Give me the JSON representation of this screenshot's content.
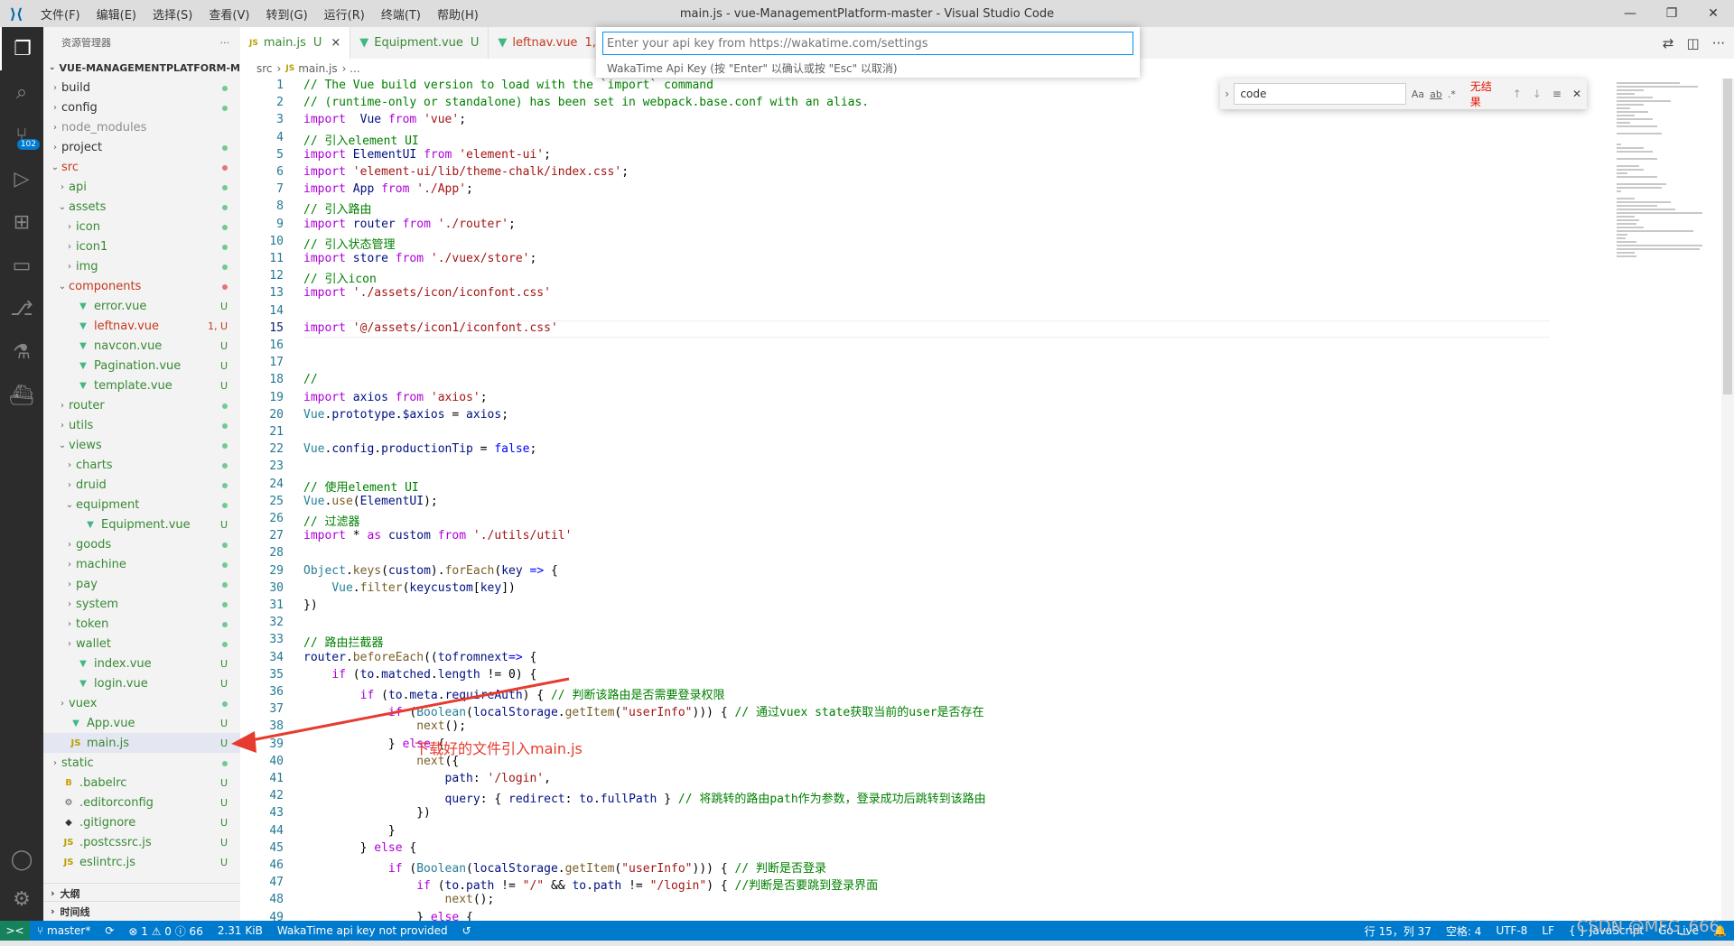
{
  "window": {
    "title": "main.js - vue-ManagementPlatform-master - Visual Studio Code",
    "menu": [
      "文件(F)",
      "编辑(E)",
      "选择(S)",
      "查看(V)",
      "转到(G)",
      "运行(R)",
      "终端(T)",
      "帮助(H)"
    ]
  },
  "activity_bar": {
    "icons": [
      "explorer-icon",
      "search-icon",
      "source-control-icon",
      "run-debug-icon",
      "extensions-icon",
      "remote-explorer-icon",
      "git-graph-icon",
      "testing-icon",
      "docker-icon"
    ],
    "scm_badge": "102",
    "bottom_icons": [
      "account-icon",
      "settings-gear-icon"
    ]
  },
  "explorer": {
    "header": "资源管理器",
    "more": "···",
    "root": "VUE-MANAGEMENTPLATFORM-MA...",
    "items": [
      {
        "label": "build",
        "indent": 0,
        "kind": "folder",
        "open": false,
        "status": "dot-green"
      },
      {
        "label": "config",
        "indent": 0,
        "kind": "folder",
        "open": false,
        "status": "dot-green"
      },
      {
        "label": "node_modules",
        "indent": 0,
        "kind": "folder",
        "open": false,
        "status": "",
        "muted": true
      },
      {
        "label": "project",
        "indent": 0,
        "kind": "folder",
        "open": false,
        "status": "dot-green"
      },
      {
        "label": "src",
        "indent": 0,
        "kind": "folder",
        "open": true,
        "status": "dot-red",
        "color": "#c5391d"
      },
      {
        "label": "api",
        "indent": 1,
        "kind": "folder",
        "open": false,
        "status": "dot-green",
        "color": "#388a34"
      },
      {
        "label": "assets",
        "indent": 1,
        "kind": "folder",
        "open": true,
        "status": "dot-green",
        "color": "#388a34"
      },
      {
        "label": "icon",
        "indent": 2,
        "kind": "folder",
        "open": false,
        "status": "dot-green",
        "color": "#388a34"
      },
      {
        "label": "icon1",
        "indent": 2,
        "kind": "folder",
        "open": false,
        "status": "dot-green",
        "color": "#388a34"
      },
      {
        "label": "img",
        "indent": 2,
        "kind": "folder",
        "open": false,
        "status": "dot-green",
        "color": "#388a34"
      },
      {
        "label": "components",
        "indent": 1,
        "kind": "folder",
        "open": true,
        "status": "dot-red",
        "color": "#c5391d"
      },
      {
        "label": "error.vue",
        "indent": 2,
        "kind": "vue",
        "status": "U",
        "color": "#388a34"
      },
      {
        "label": "leftnav.vue",
        "indent": 2,
        "kind": "vue",
        "status": "1, U",
        "color": "#c5391d"
      },
      {
        "label": "navcon.vue",
        "indent": 2,
        "kind": "vue",
        "status": "U",
        "color": "#388a34"
      },
      {
        "label": "Pagination.vue",
        "indent": 2,
        "kind": "vue",
        "status": "U",
        "color": "#388a34"
      },
      {
        "label": "template.vue",
        "indent": 2,
        "kind": "vue",
        "status": "U",
        "color": "#388a34"
      },
      {
        "label": "router",
        "indent": 1,
        "kind": "folder",
        "open": false,
        "status": "dot-green",
        "color": "#388a34"
      },
      {
        "label": "utils",
        "indent": 1,
        "kind": "folder",
        "open": false,
        "status": "dot-green",
        "color": "#388a34"
      },
      {
        "label": "views",
        "indent": 1,
        "kind": "folder",
        "open": true,
        "status": "dot-green",
        "color": "#388a34"
      },
      {
        "label": "charts",
        "indent": 2,
        "kind": "folder",
        "open": false,
        "status": "dot-green",
        "color": "#388a34"
      },
      {
        "label": "druid",
        "indent": 2,
        "kind": "folder",
        "open": false,
        "status": "dot-green",
        "color": "#388a34"
      },
      {
        "label": "equipment",
        "indent": 2,
        "kind": "folder",
        "open": true,
        "status": "dot-green",
        "color": "#388a34"
      },
      {
        "label": "Equipment.vue",
        "indent": 3,
        "kind": "vue",
        "status": "U",
        "color": "#388a34"
      },
      {
        "label": "goods",
        "indent": 2,
        "kind": "folder",
        "open": false,
        "status": "dot-green",
        "color": "#388a34"
      },
      {
        "label": "machine",
        "indent": 2,
        "kind": "folder",
        "open": false,
        "status": "dot-green",
        "color": "#388a34"
      },
      {
        "label": "pay",
        "indent": 2,
        "kind": "folder",
        "open": false,
        "status": "dot-green",
        "color": "#388a34"
      },
      {
        "label": "system",
        "indent": 2,
        "kind": "folder",
        "open": false,
        "status": "dot-green",
        "color": "#388a34"
      },
      {
        "label": "token",
        "indent": 2,
        "kind": "folder",
        "open": false,
        "status": "dot-green",
        "color": "#388a34"
      },
      {
        "label": "wallet",
        "indent": 2,
        "kind": "folder",
        "open": false,
        "status": "dot-green",
        "color": "#388a34"
      },
      {
        "label": "index.vue",
        "indent": 2,
        "kind": "vue",
        "status": "U",
        "color": "#388a34"
      },
      {
        "label": "login.vue",
        "indent": 2,
        "kind": "vue",
        "status": "U",
        "color": "#388a34"
      },
      {
        "label": "vuex",
        "indent": 1,
        "kind": "folder",
        "open": false,
        "status": "dot-green",
        "color": "#388a34"
      },
      {
        "label": "App.vue",
        "indent": 1,
        "kind": "vue",
        "status": "U",
        "color": "#388a34"
      },
      {
        "label": "main.js",
        "indent": 1,
        "kind": "js",
        "status": "U",
        "color": "#388a34",
        "selected": true
      },
      {
        "label": "static",
        "indent": 0,
        "kind": "folder",
        "open": false,
        "status": "dot-green",
        "color": "#388a34"
      },
      {
        "label": ".babelrc",
        "indent": 0,
        "kind": "babel",
        "status": "U",
        "color": "#388a34"
      },
      {
        "label": ".editorconfig",
        "indent": 0,
        "kind": "gear",
        "status": "U",
        "color": "#388a34"
      },
      {
        "label": ".gitignore",
        "indent": 0,
        "kind": "git",
        "status": "U",
        "color": "#388a34"
      },
      {
        "label": ".postcssrc.js",
        "indent": 0,
        "kind": "js",
        "status": "U",
        "color": "#388a34"
      },
      {
        "label": "eslintrc.js",
        "indent": 0,
        "kind": "js",
        "status": "U",
        "color": "#388a34"
      }
    ],
    "outline": "大纲",
    "timeline": "时间线"
  },
  "tabs": [
    {
      "label": "main.js",
      "kind": "js",
      "status": "U",
      "active": true,
      "close": "×"
    },
    {
      "label": "Equipment.vue",
      "kind": "vue",
      "status": "U",
      "active": false
    },
    {
      "label": "leftnav.vue",
      "kind": "vue",
      "status": "1, U",
      "active": false
    }
  ],
  "breadcrumb": [
    "src",
    "›",
    "main.js",
    "› ..."
  ],
  "quick_input": {
    "placeholder": "Enter your api key from https://wakatime.com/settings",
    "message": "WakaTime Api Key (按 \"Enter\" 以确认或按 \"Esc\" 以取消)"
  },
  "find_widget": {
    "query": "code",
    "options": [
      "Aa",
      "ab",
      ".*"
    ],
    "result": "无结果"
  },
  "code_lines": [
    [
      [
        "c",
        "// The Vue build version to load with the `import` command"
      ]
    ],
    [
      [
        "c",
        "// (runtime-only or standalone) has been set in webpack.base.conf with an alias."
      ]
    ],
    [
      [
        "kc",
        "import"
      ],
      [
        "",
        "  "
      ],
      [
        "v",
        "Vue"
      ],
      [
        "",
        " "
      ],
      [
        "kc",
        "from"
      ],
      [
        "",
        " "
      ],
      [
        "s",
        "'vue'"
      ],
      [
        "",
        ";"
      ]
    ],
    [
      [
        "c",
        "// 引入element UI"
      ]
    ],
    [
      [
        "kc",
        "import"
      ],
      [
        "",
        " "
      ],
      [
        "v",
        "ElementUI"
      ],
      [
        "",
        " "
      ],
      [
        "kc",
        "from"
      ],
      [
        "",
        " "
      ],
      [
        "s",
        "'element-ui'"
      ],
      [
        "",
        ";"
      ]
    ],
    [
      [
        "kc",
        "import"
      ],
      [
        "",
        " "
      ],
      [
        "s",
        "'element-ui/lib/theme-chalk/index.css'"
      ],
      [
        "",
        ";"
      ]
    ],
    [
      [
        "kc",
        "import"
      ],
      [
        "",
        " "
      ],
      [
        "v",
        "App"
      ],
      [
        "",
        " "
      ],
      [
        "kc",
        "from"
      ],
      [
        "",
        " "
      ],
      [
        "s",
        "'./App'"
      ],
      [
        "",
        ";"
      ]
    ],
    [
      [
        "c",
        "// 引入路由"
      ]
    ],
    [
      [
        "kc",
        "import"
      ],
      [
        "",
        " "
      ],
      [
        "v",
        "router"
      ],
      [
        "",
        " "
      ],
      [
        "kc",
        "from"
      ],
      [
        "",
        " "
      ],
      [
        "s",
        "'./router'"
      ],
      [
        "",
        ";"
      ]
    ],
    [
      [
        "c",
        "// 引入状态管理"
      ]
    ],
    [
      [
        "kc",
        "import"
      ],
      [
        "",
        " "
      ],
      [
        "v",
        "store"
      ],
      [
        "",
        " "
      ],
      [
        "kc",
        "from"
      ],
      [
        "",
        " "
      ],
      [
        "s",
        "'./vuex/store'"
      ],
      [
        "",
        ";"
      ]
    ],
    [
      [
        "c",
        "// 引入icon"
      ]
    ],
    [
      [
        "kc",
        "import"
      ],
      [
        "",
        " "
      ],
      [
        "s",
        "'./assets/icon/iconfont.css'"
      ]
    ],
    [
      [
        "",
        ""
      ]
    ],
    [
      [
        "kc",
        "import"
      ],
      [
        "",
        " "
      ],
      [
        "s",
        "'@/assets/icon1/iconfont.css'"
      ]
    ],
    [
      [
        "",
        ""
      ]
    ],
    [
      [
        "",
        ""
      ]
    ],
    [
      [
        "c",
        "//"
      ]
    ],
    [
      [
        "kc",
        "import"
      ],
      [
        "",
        " "
      ],
      [
        "v",
        "axios"
      ],
      [
        "",
        " "
      ],
      [
        "kc",
        "from"
      ],
      [
        "",
        " "
      ],
      [
        "s",
        "'axios'"
      ],
      [
        "",
        ";"
      ]
    ],
    [
      [
        "t",
        "Vue"
      ],
      [
        "",
        "."
      ],
      [
        "v",
        "prototype"
      ],
      [
        "",
        "."
      ],
      [
        "v",
        "$axios"
      ],
      [
        "",
        " = "
      ],
      [
        "v",
        "axios"
      ],
      [
        "",
        ";"
      ]
    ],
    [
      [
        "",
        ""
      ]
    ],
    [
      [
        "t",
        "Vue"
      ],
      [
        "",
        "."
      ],
      [
        "v",
        "config"
      ],
      [
        "",
        "."
      ],
      [
        "v",
        "productionTip"
      ],
      [
        "",
        " = "
      ],
      [
        "k",
        "false"
      ],
      [
        "",
        ";"
      ]
    ],
    [
      [
        "",
        ""
      ]
    ],
    [
      [
        "c",
        "// 使用element UI"
      ]
    ],
    [
      [
        "t",
        "Vue"
      ],
      [
        "",
        "."
      ],
      [
        "f",
        "use"
      ],
      [
        "",
        "("
      ],
      [
        "v",
        "ElementUI"
      ],
      [
        "",
        ");"
      ]
    ],
    [
      [
        "c",
        "// 过滤器"
      ]
    ],
    [
      [
        "kc",
        "import"
      ],
      [
        "",
        " * "
      ],
      [
        "kc",
        "as"
      ],
      [
        "",
        " "
      ],
      [
        "v",
        "custom"
      ],
      [
        "",
        " "
      ],
      [
        "kc",
        "from"
      ],
      [
        "",
        " "
      ],
      [
        "s",
        "'./utils/util'"
      ]
    ],
    [
      [
        "",
        ""
      ]
    ],
    [
      [
        "t",
        "Object"
      ],
      [
        "",
        "."
      ],
      [
        "f",
        "keys"
      ],
      [
        "",
        "("
      ],
      [
        "v",
        "custom"
      ],
      [
        "",
        ")."
      ],
      [
        "f",
        "forEach"
      ],
      [
        "",
        "("
      ],
      [
        "v",
        "key"
      ],
      [
        "",
        " "
      ],
      [
        "k",
        "=>"
      ],
      [
        "",
        " {"
      ]
    ],
    [
      [
        "",
        "    "
      ],
      [
        "t",
        "Vue"
      ],
      [
        "",
        "."
      ],
      [
        "f",
        "filter"
      ],
      [
        "",
        "("
      ],
      [
        "v",
        "key"
      ],
      [
        ", "
      ],
      [
        "v",
        "custom"
      ],
      [
        "",
        "["
      ],
      [
        "v",
        "key"
      ],
      [
        "",
        "])"
      ]
    ],
    [
      [
        "",
        "})"
      ]
    ],
    [
      [
        "",
        ""
      ]
    ],
    [
      [
        "c",
        "// 路由拦截器"
      ]
    ],
    [
      [
        "v",
        "router"
      ],
      [
        "",
        "."
      ],
      [
        "f",
        "beforeEach"
      ],
      [
        "",
        "(("
      ],
      [
        "v",
        "to"
      ],
      [
        ", "
      ],
      [
        "v",
        "from"
      ],
      [
        ", "
      ],
      [
        "v",
        "next"
      ],
      [
        ") "
      ],
      [
        "k",
        "=>"
      ],
      [
        "",
        " {"
      ]
    ],
    [
      [
        "",
        "    "
      ],
      [
        "kc",
        "if"
      ],
      [
        "",
        " ("
      ],
      [
        "v",
        "to"
      ],
      [
        "",
        "."
      ],
      [
        "v",
        "matched"
      ],
      [
        "",
        "."
      ],
      [
        "v",
        "length"
      ],
      [
        "",
        " != "
      ],
      [
        "",
        "0) {"
      ]
    ],
    [
      [
        "",
        "        "
      ],
      [
        "kc",
        "if"
      ],
      [
        "",
        " ("
      ],
      [
        "v",
        "to"
      ],
      [
        "",
        "."
      ],
      [
        "v",
        "meta"
      ],
      [
        "",
        "."
      ],
      [
        "v",
        "requireAuth"
      ],
      [
        "",
        ") { "
      ],
      [
        "c",
        "// 判断该路由是否需要登录权限"
      ]
    ],
    [
      [
        "",
        "            "
      ],
      [
        "kc",
        "if"
      ],
      [
        "",
        " ("
      ],
      [
        "t",
        "Boolean"
      ],
      [
        "",
        "("
      ],
      [
        "v",
        "localStorage"
      ],
      [
        "",
        "."
      ],
      [
        "f",
        "getItem"
      ],
      [
        "",
        "("
      ],
      [
        "s",
        "\"userInfo\""
      ],
      [
        "",
        "))) { "
      ],
      [
        "c",
        "// 通过vuex state获取当前的user是否存在"
      ]
    ],
    [
      [
        "",
        "                "
      ],
      [
        "f",
        "next"
      ],
      [
        "",
        "();"
      ]
    ],
    [
      [
        "",
        "            } "
      ],
      [
        "kc",
        "else"
      ],
      [
        "",
        " {"
      ]
    ],
    [
      [
        "",
        "                "
      ],
      [
        "f",
        "next"
      ],
      [
        "",
        "({"
      ]
    ],
    [
      [
        "",
        "                    "
      ],
      [
        "v",
        "path"
      ],
      [
        "",
        ": "
      ],
      [
        "s",
        "'/login'"
      ],
      [
        "",
        ","
      ]
    ],
    [
      [
        "",
        "                    "
      ],
      [
        "v",
        "query"
      ],
      [
        "",
        ": { "
      ],
      [
        "v",
        "redirect"
      ],
      [
        "",
        ": "
      ],
      [
        "v",
        "to"
      ],
      [
        "",
        "."
      ],
      [
        "v",
        "fullPath"
      ],
      [
        "",
        " } "
      ],
      [
        "c",
        "// 将跳转的路由path作为参数，登录成功后跳转到该路由"
      ]
    ],
    [
      [
        "",
        "                })"
      ]
    ],
    [
      [
        "",
        "            }"
      ]
    ],
    [
      [
        "",
        "        } "
      ],
      [
        "kc",
        "else"
      ],
      [
        "",
        " {"
      ]
    ],
    [
      [
        "",
        "            "
      ],
      [
        "kc",
        "if"
      ],
      [
        "",
        " ("
      ],
      [
        "t",
        "Boolean"
      ],
      [
        "",
        "("
      ],
      [
        "v",
        "localStorage"
      ],
      [
        "",
        "."
      ],
      [
        "f",
        "getItem"
      ],
      [
        "",
        "("
      ],
      [
        "s",
        "\"userInfo\""
      ],
      [
        "",
        "))) { "
      ],
      [
        "c",
        "// 判断是否登录"
      ]
    ],
    [
      [
        "",
        "                "
      ],
      [
        "kc",
        "if"
      ],
      [
        "",
        " ("
      ],
      [
        "v",
        "to"
      ],
      [
        "",
        "."
      ],
      [
        "v",
        "path"
      ],
      [
        "",
        " != "
      ],
      [
        "s",
        "\"/\""
      ],
      [
        "",
        " && "
      ],
      [
        "v",
        "to"
      ],
      [
        "",
        "."
      ],
      [
        "v",
        "path"
      ],
      [
        "",
        " != "
      ],
      [
        "s",
        "\"/login\""
      ],
      [
        "",
        ") { "
      ],
      [
        "c",
        "//判断是否要跳到登录界面"
      ]
    ],
    [
      [
        "",
        "                    "
      ],
      [
        "f",
        "next"
      ],
      [
        "",
        "();"
      ]
    ],
    [
      [
        "",
        "                } "
      ],
      [
        "kc",
        "else"
      ],
      [
        "",
        " {"
      ]
    ]
  ],
  "current_line": 15,
  "annotation": "下载好的文件引入main.js",
  "statusbar": {
    "remote": "><",
    "branch": "master*",
    "sync": "⟳",
    "problems": "⊗ 1 ⚠ 0 ⓘ 66",
    "size": "2.31 KiB",
    "wakatime": "WakaTime api key not provided",
    "history": "↺",
    "position": "行 15，列 37",
    "spaces": "空格: 4",
    "encoding": "UTF-8",
    "eol": "LF",
    "language": "{ } JavaScript",
    "extra": "Go Live"
  },
  "watermark": "CSDN @MFG_666"
}
